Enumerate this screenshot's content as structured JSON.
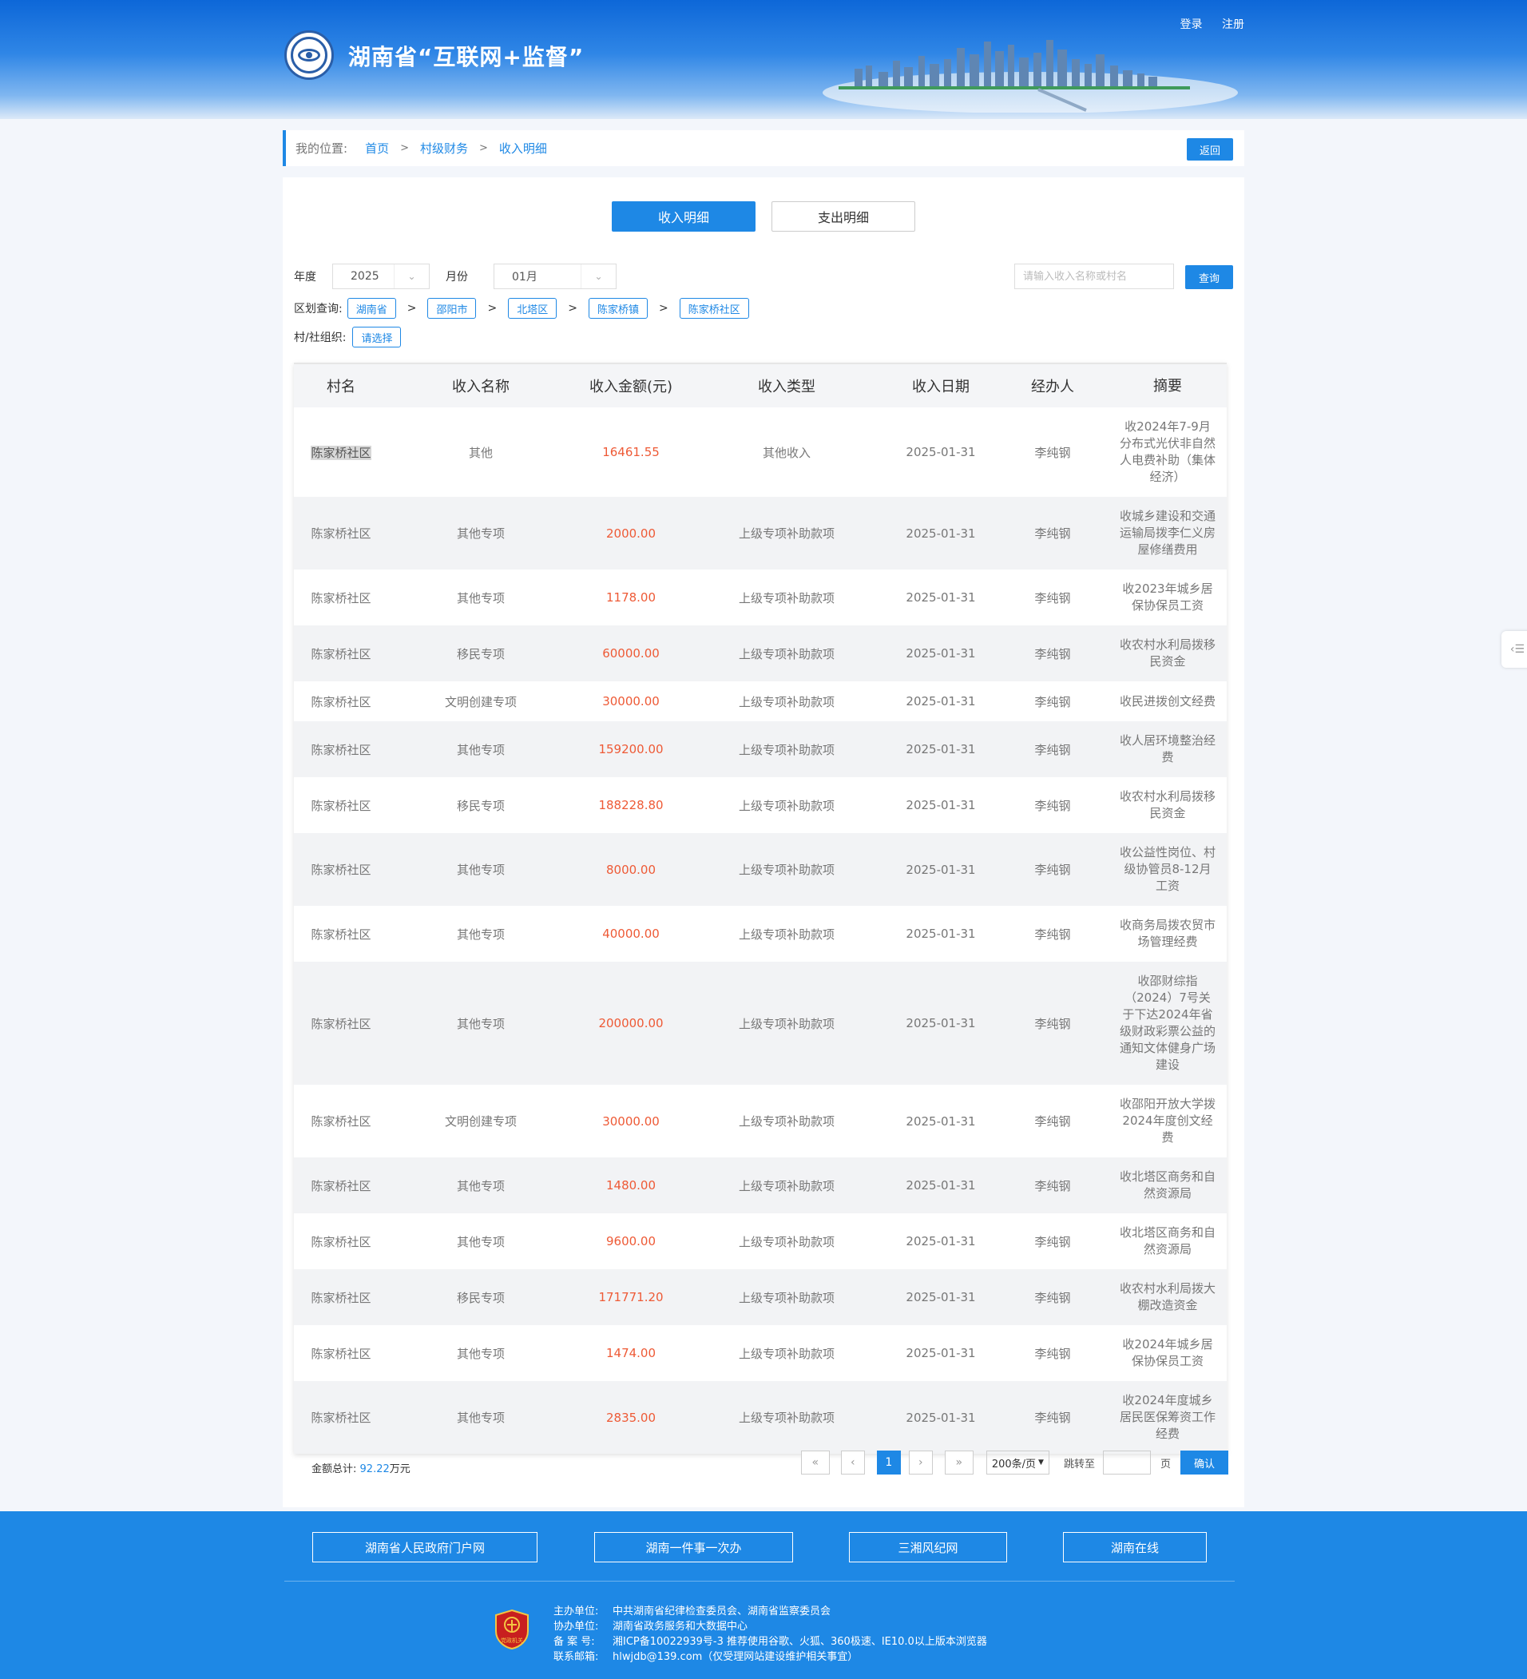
{
  "header": {
    "site_title": "湖南省“互联网+监督”",
    "login": "登录",
    "register": "注册"
  },
  "breadcrumb": {
    "label": "我的位置:",
    "items": [
      "首页",
      "村级财务",
      "收入明细"
    ],
    "separator": ">",
    "back_label": "返回"
  },
  "tabs": [
    {
      "label": "收入明细",
      "active": true
    },
    {
      "label": "支出明细",
      "active": false
    }
  ],
  "filters": {
    "year_label": "年度",
    "year_value": "2025",
    "month_label": "月份",
    "month_value": "01月",
    "search_placeholder": "请输入收入名称或村名",
    "query_label": "查询",
    "region_label": "区划查询:",
    "region_chips": [
      "湖南省",
      "邵阳市",
      "北塔区",
      "陈家桥镇",
      "陈家桥社区"
    ],
    "org_label": "村/社组织:",
    "org_select": "请选择"
  },
  "table": {
    "headers": [
      "村名",
      "收入名称",
      "收入金额(元)",
      "收入类型",
      "收入日期",
      "经办人",
      "摘要"
    ],
    "rows": [
      {
        "village": "陈家桥社区",
        "name": "其他",
        "amount": "16461.55",
        "type": "其他收入",
        "date": "2025-01-31",
        "handler": "李纯钢",
        "summary": "收2024年7-9月分布式光伏非自然人电费补助（集体经济）"
      },
      {
        "village": "陈家桥社区",
        "name": "其他专项",
        "amount": "2000.00",
        "type": "上级专项补助款项",
        "date": "2025-01-31",
        "handler": "李纯钢",
        "summary": "收城乡建设和交通运输局拨李仁义房屋修缮费用"
      },
      {
        "village": "陈家桥社区",
        "name": "其他专项",
        "amount": "1178.00",
        "type": "上级专项补助款项",
        "date": "2025-01-31",
        "handler": "李纯钢",
        "summary": "收2023年城乡居保协保员工资"
      },
      {
        "village": "陈家桥社区",
        "name": "移民专项",
        "amount": "60000.00",
        "type": "上级专项补助款项",
        "date": "2025-01-31",
        "handler": "李纯钢",
        "summary": "收农村水利局拨移民资金"
      },
      {
        "village": "陈家桥社区",
        "name": "文明创建专项",
        "amount": "30000.00",
        "type": "上级专项补助款项",
        "date": "2025-01-31",
        "handler": "李纯钢",
        "summary": "收民进拨创文经费"
      },
      {
        "village": "陈家桥社区",
        "name": "其他专项",
        "amount": "159200.00",
        "type": "上级专项补助款项",
        "date": "2025-01-31",
        "handler": "李纯钢",
        "summary": "收人居环境整治经费"
      },
      {
        "village": "陈家桥社区",
        "name": "移民专项",
        "amount": "188228.80",
        "type": "上级专项补助款项",
        "date": "2025-01-31",
        "handler": "李纯钢",
        "summary": "收农村水利局拨移民资金"
      },
      {
        "village": "陈家桥社区",
        "name": "其他专项",
        "amount": "8000.00",
        "type": "上级专项补助款项",
        "date": "2025-01-31",
        "handler": "李纯钢",
        "summary": "收公益性岗位、村级协管员8-12月工资"
      },
      {
        "village": "陈家桥社区",
        "name": "其他专项",
        "amount": "40000.00",
        "type": "上级专项补助款项",
        "date": "2025-01-31",
        "handler": "李纯钢",
        "summary": "收商务局拨农贸市场管理经费"
      },
      {
        "village": "陈家桥社区",
        "name": "其他专项",
        "amount": "200000.00",
        "type": "上级专项补助款项",
        "date": "2025-01-31",
        "handler": "李纯钢",
        "summary": "收邵财综指（2024）7号关于下达2024年省级财政彩票公益的通知文体健身广场建设"
      },
      {
        "village": "陈家桥社区",
        "name": "文明创建专项",
        "amount": "30000.00",
        "type": "上级专项补助款项",
        "date": "2025-01-31",
        "handler": "李纯钢",
        "summary": "收邵阳开放大学拨2024年度创文经费"
      },
      {
        "village": "陈家桥社区",
        "name": "其他专项",
        "amount": "1480.00",
        "type": "上级专项补助款项",
        "date": "2025-01-31",
        "handler": "李纯钢",
        "summary": "收北塔区商务和自然资源局"
      },
      {
        "village": "陈家桥社区",
        "name": "其他专项",
        "amount": "9600.00",
        "type": "上级专项补助款项",
        "date": "2025-01-31",
        "handler": "李纯钢",
        "summary": "收北塔区商务和自然资源局"
      },
      {
        "village": "陈家桥社区",
        "name": "移民专项",
        "amount": "171771.20",
        "type": "上级专项补助款项",
        "date": "2025-01-31",
        "handler": "李纯钢",
        "summary": "收农村水利局拨大棚改造资金"
      },
      {
        "village": "陈家桥社区",
        "name": "其他专项",
        "amount": "1474.00",
        "type": "上级专项补助款项",
        "date": "2025-01-31",
        "handler": "李纯钢",
        "summary": "收2024年城乡居保协保员工资"
      },
      {
        "village": "陈家桥社区",
        "name": "其他专项",
        "amount": "2835.00",
        "type": "上级专项补助款项",
        "date": "2025-01-31",
        "handler": "李纯钢",
        "summary": "收2024年度城乡居民医保筹资工作经费"
      }
    ]
  },
  "summary": {
    "label": "金额总计:",
    "value": "92.22",
    "unit": "万元"
  },
  "pager": {
    "first": "«",
    "prev": "‹",
    "current": "1",
    "next": "›",
    "last": "»",
    "page_size": "200条/页",
    "jump_label": "跳转至",
    "page_suffix": "页",
    "confirm": "确认"
  },
  "footer": {
    "links": [
      "湖南省人民政府门户网",
      "湖南一件事一次办",
      "三湘风纪网",
      "湖南在线"
    ],
    "badge_text": "党政机关",
    "info": [
      {
        "k": "主办单位:",
        "v": "中共湖南省纪律检查委员会、湖南省监察委员会"
      },
      {
        "k": "协办单位:",
        "v": "湖南省政务服务和大数据中心"
      },
      {
        "k": "备  案  号:",
        "v": "湘ICP备10022939号-3   推荐使用谷歌、火狐、360极速、IE10.0以上版本浏览器"
      },
      {
        "k": "联系邮箱:",
        "v": "hlwjdb@139.com（仅受理网站建设维护相关事宜）"
      }
    ]
  },
  "colors": {
    "primary": "#1e88e5",
    "amount": "#ee5a36",
    "footer": "#1e88e5"
  }
}
